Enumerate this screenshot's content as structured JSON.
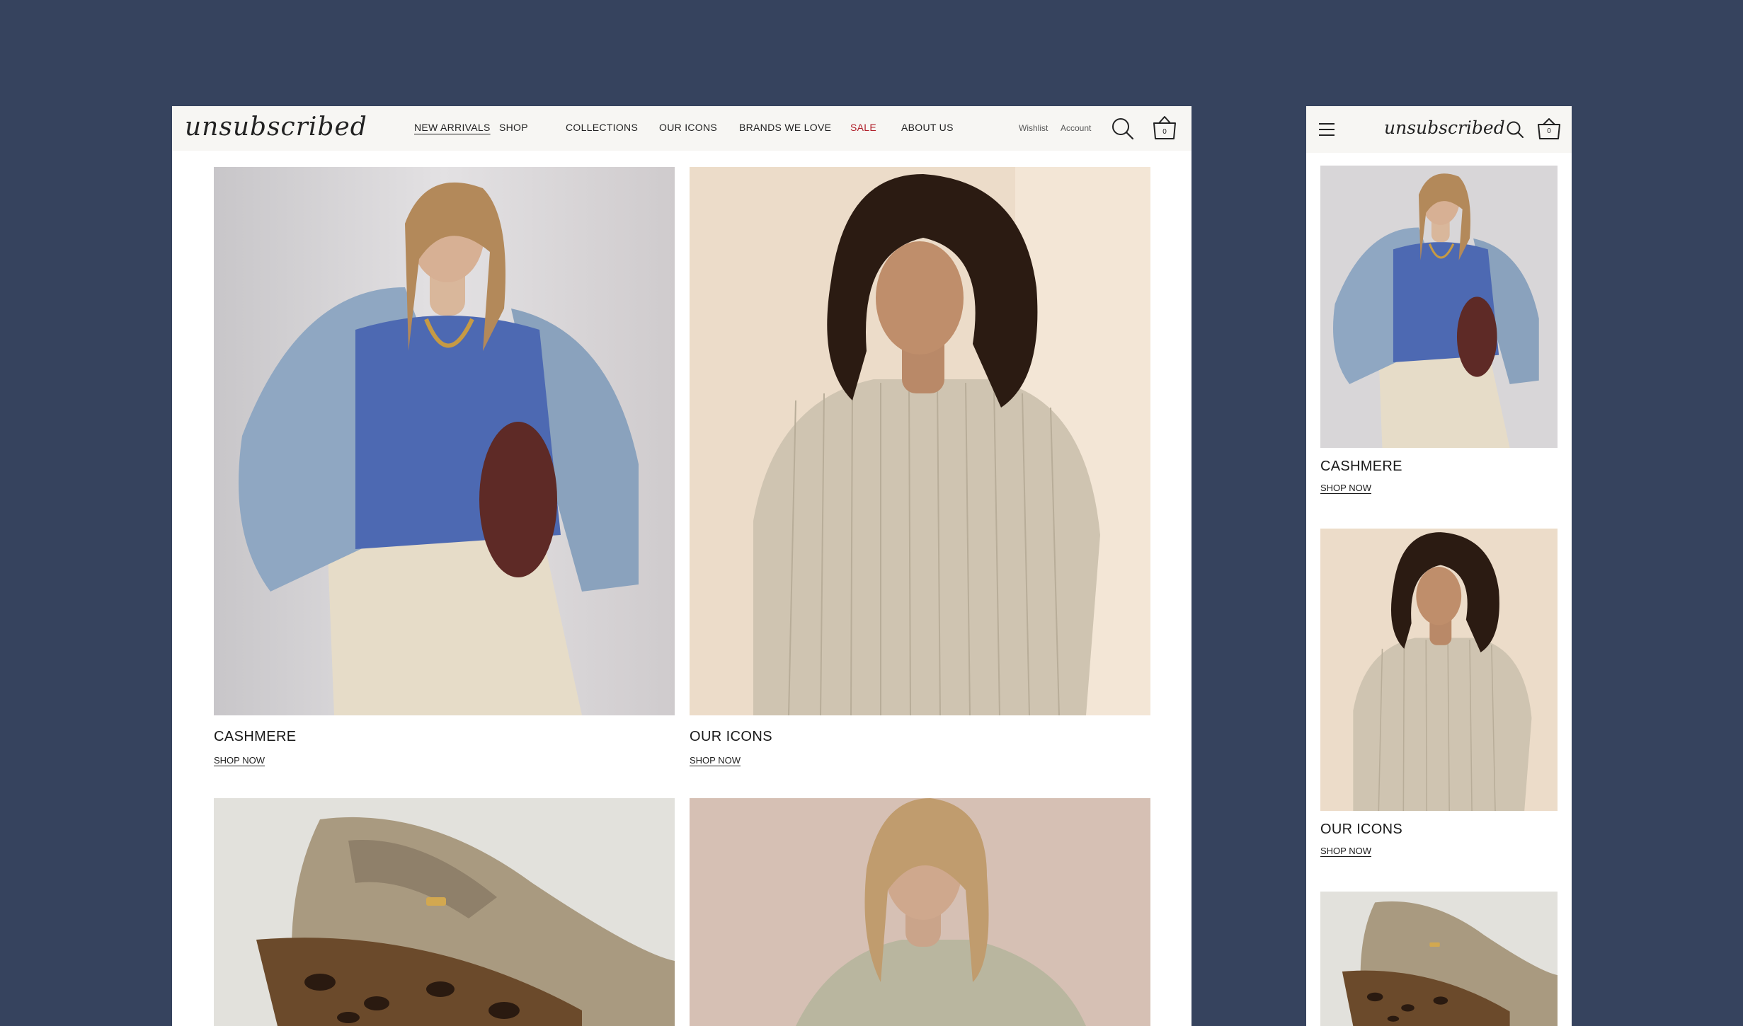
{
  "desktop": {
    "logo": "unsubscribed",
    "nav": [
      {
        "label": "NEW ARRIVALS"
      },
      {
        "label": "SHOP"
      },
      {
        "label": "COLLECTIONS"
      },
      {
        "label": "OUR ICONS"
      },
      {
        "label": "BRANDS WE LOVE"
      },
      {
        "label": "SALE"
      },
      {
        "label": "ABOUT US"
      }
    ],
    "wishlist": "Wishlist",
    "account": "Account",
    "cart_count": "0",
    "cards": [
      {
        "title": "CASHMERE",
        "cta": "SHOP NOW"
      },
      {
        "title": "OUR ICONS",
        "cta": "SHOP NOW"
      }
    ]
  },
  "mobile": {
    "logo": "unsubscribed",
    "cart_count": "0",
    "cards": [
      {
        "title": "CASHMERE",
        "cta": "SHOP NOW"
      },
      {
        "title": "OUR ICONS",
        "cta": "SHOP NOW"
      }
    ]
  },
  "colors": {
    "background": "#36435e",
    "header": "#f7f6f3",
    "sale": "#b0202a"
  },
  "icons": [
    "menu-icon",
    "search-icon",
    "cart-icon"
  ]
}
